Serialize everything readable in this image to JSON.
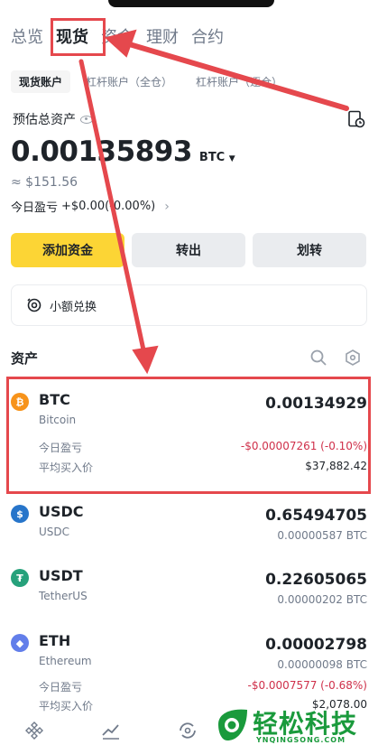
{
  "tabs": [
    {
      "label": "总览",
      "active": false
    },
    {
      "label": "现货",
      "active": true
    },
    {
      "label": "资金",
      "active": false
    },
    {
      "label": "理财",
      "active": false
    },
    {
      "label": "合约",
      "active": false
    }
  ],
  "subtabs": [
    {
      "label": "现货账户",
      "active": true
    },
    {
      "label": "杠杆账户（全仓）",
      "active": false
    },
    {
      "label": "杠杆账户（逐仓）",
      "active": false
    }
  ],
  "summary": {
    "est_label": "预估总资产",
    "balance": "0.00135893",
    "unit": "BTC",
    "usd_value": "≈ $151.56",
    "pnl_label": "今日盈亏",
    "pnl_value": "+$0.00(-0.00%)"
  },
  "actions": {
    "deposit": "添加资金",
    "transfer_out": "转出",
    "transfer": "划转"
  },
  "convert": {
    "label": "小额兑换"
  },
  "assets_header": "资产",
  "assets": [
    {
      "symbol": "BTC",
      "name": "Bitcoin",
      "amount": "0.00134929",
      "sub": "",
      "pnl_label": "今日盈亏",
      "pnl": "-$0.00007261 (-0.10%)",
      "avg_label": "平均买入价",
      "avg": "$37,882.42",
      "icon": "bitcoin-icon",
      "color": "#f7931a",
      "glyph": "₿"
    },
    {
      "symbol": "USDC",
      "name": "USDC",
      "amount": "0.65494705",
      "sub": "0.00000587 BTC",
      "icon": "usdc-icon",
      "color": "#2775ca",
      "glyph": "$"
    },
    {
      "symbol": "USDT",
      "name": "TetherUS",
      "amount": "0.22605065",
      "sub": "0.00000202 BTC",
      "icon": "tether-icon",
      "color": "#26a17b",
      "glyph": "₮"
    },
    {
      "symbol": "ETH",
      "name": "Ethereum",
      "amount": "0.00002798",
      "sub": "0.00000098 BTC",
      "pnl_label": "今日盈亏",
      "pnl": "-$0.0007577 (-0.68%)",
      "avg_label": "平均买入价",
      "avg": "$2,078.00",
      "icon": "ethereum-icon",
      "color": "#627eea",
      "glyph": "◆"
    }
  ],
  "watermark": {
    "big": "轻松科技",
    "small": "YNQINGSONG.COM"
  },
  "colors": {
    "accent": "#fcd535",
    "negative": "#cf304a",
    "annotation": "#e5484d"
  }
}
